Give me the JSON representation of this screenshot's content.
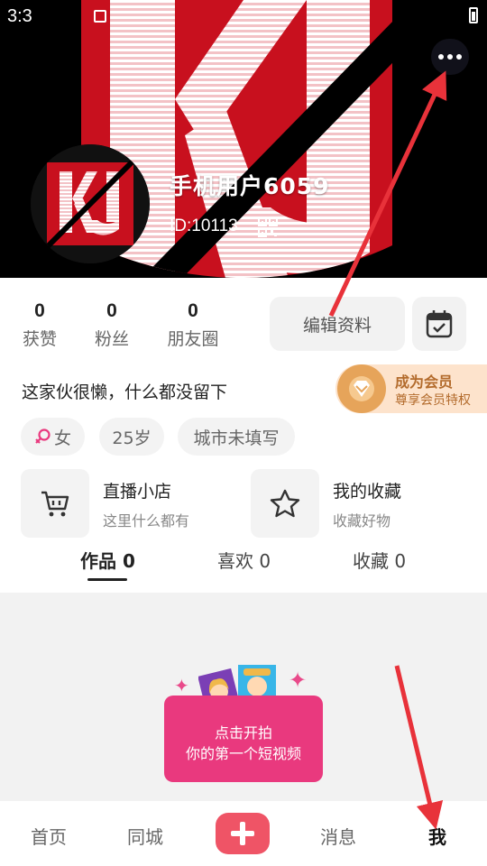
{
  "colors": {
    "accent_pink": "#e9397e",
    "vip_text": "#b36b2c",
    "vip_background": "#fde3cc",
    "nav_plus": "#ef5466",
    "annotation_arrow": "#e8323a",
    "cover_red": "#c8101e"
  },
  "status_bar": {
    "time": "3:3"
  },
  "header": {
    "cover_logo_text": "KJ",
    "username": "手机用户6059",
    "user_id": "ID:10113",
    "more_icon": "more-horizontal-icon",
    "qr_icon": "qr-code-icon"
  },
  "stats": [
    {
      "value": "0",
      "label": "获赞"
    },
    {
      "value": "0",
      "label": "粉丝"
    },
    {
      "value": "0",
      "label": "朋友圈"
    }
  ],
  "actions": {
    "edit_profile_label": "编辑资料",
    "calendar_icon": "calendar-check-icon"
  },
  "bio": "这家伙很懒，什么都没留下",
  "vip": {
    "title": "成为会员",
    "subtitle": "尊享会员特权",
    "icon": "diamond-icon"
  },
  "tags": {
    "gender_icon": "female-icon",
    "gender": "女",
    "age": "25岁",
    "city": "城市未填写"
  },
  "shortcuts": [
    {
      "title": "直播小店",
      "desc": "这里什么都有",
      "icon": "cart-icon"
    },
    {
      "title": "我的收藏",
      "desc": "收藏好物",
      "icon": "star-icon"
    }
  ],
  "content_tabs": [
    {
      "label": "作品 0",
      "active": true
    },
    {
      "label": "喜欢 0",
      "active": false
    },
    {
      "label": "收藏 0",
      "active": false
    }
  ],
  "empty_state": {
    "line1": "点击开拍",
    "line2": "你的第一个短视频"
  },
  "bottom_nav": {
    "home": "首页",
    "nearby": "同城",
    "create_icon": "plus-icon",
    "messages": "消息",
    "me": "我"
  }
}
